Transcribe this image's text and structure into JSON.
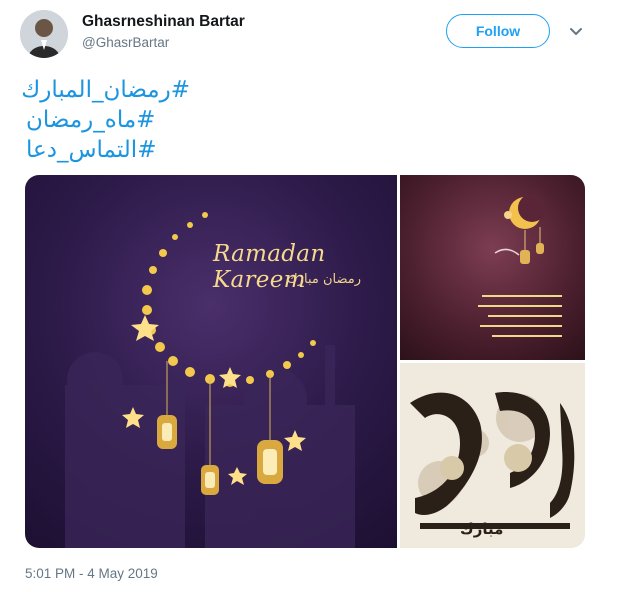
{
  "author": {
    "name": "Ghasrneshinan Bartar",
    "handle": "@GhasrBartar"
  },
  "follow_label": "Follow",
  "hashtags": [
    "#رمضان_المبارك",
    "#ماه_رمضان",
    "#التماس_دعا"
  ],
  "media": {
    "image1_title": "Ramadan Kareem",
    "image1_subtitle": "رمضان مبارك",
    "image3_caption": "مبارك"
  },
  "timestamp": "5:01 PM - 4 May 2019",
  "colors": {
    "accent": "#1da1f2",
    "hashtag": "#1b95e0",
    "secondary_text": "#657786"
  }
}
